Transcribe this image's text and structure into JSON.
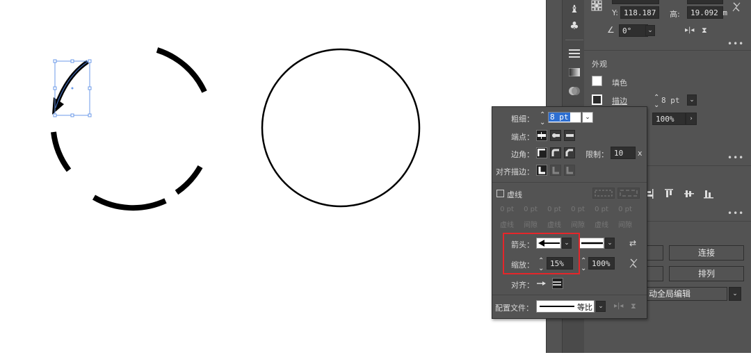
{
  "transform": {
    "y_label": "Y:",
    "y_value": "118.187",
    "h_label": "高:",
    "h_value": "19.092 m",
    "angle_value": "0°"
  },
  "appearance": {
    "title": "外观",
    "fill_label": "填色",
    "stroke_label": "描边",
    "stroke_weight": "8 pt",
    "opacity_value": "100%"
  },
  "buttons": {
    "connect": "连接",
    "arrange": "排列",
    "global_edit": "动全局编辑"
  },
  "stroke_panel": {
    "weight_label": "粗细：",
    "weight_value": "8 pt",
    "cap_label": "端点：",
    "corner_label": "边角：",
    "limit_label": "限制：",
    "limit_value": "10",
    "limit_unit": "x",
    "align_stroke_label": "对齐描边：",
    "dashed_label": "虚线",
    "dash_values": [
      "0 pt",
      "0 pt",
      "0 pt",
      "0 pt",
      "0 pt",
      "0 pt"
    ],
    "dash_labels": [
      "虚线",
      "间隙",
      "虚线",
      "间隙",
      "虚线",
      "间隙"
    ],
    "arrow_label": "箭头：",
    "scale_label": "缩放：",
    "scale_start": "15%",
    "scale_end": "100%",
    "align_label": "对齐：",
    "profile_label": "配置文件：",
    "profile_value": "等比"
  },
  "colors": {
    "panel_bg": "#535353",
    "highlight_red": "#e5262a",
    "selection_blue": "#4a7cd8"
  }
}
